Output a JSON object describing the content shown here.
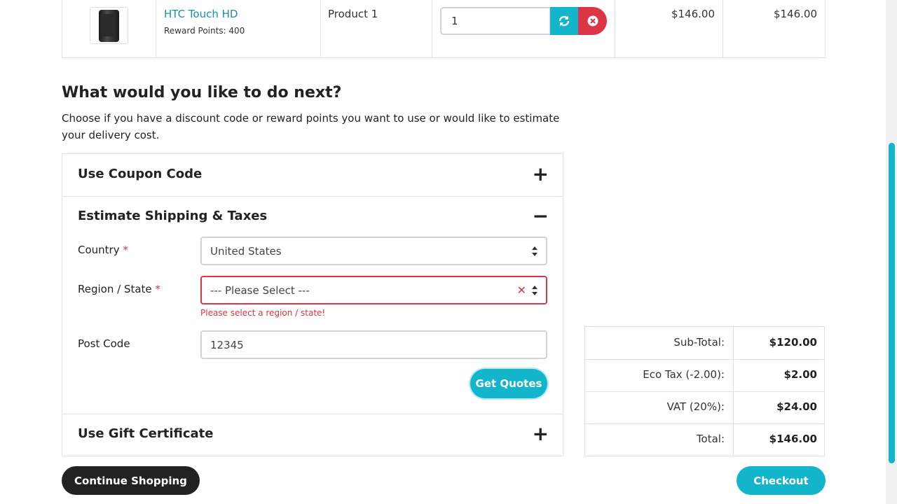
{
  "cart": {
    "product_name": "HTC Touch HD",
    "reward_points": "Reward Points: 400",
    "model": "Product 1",
    "quantity": "1",
    "unit_price": "$146.00",
    "total": "$146.00"
  },
  "next": {
    "heading": "What would you like to do next?",
    "description": "Choose if you have a discount code or reward points you want to use or would like to estimate your delivery cost."
  },
  "coupon": {
    "title": "Use Coupon Code",
    "toggle": "+"
  },
  "shipping": {
    "title": "Estimate Shipping & Taxes",
    "toggle": "−",
    "country_label": "Country",
    "country_value": "United States",
    "region_label": "Region / State",
    "region_value": "--- Please Select ---",
    "region_error": "Please select a region / state!",
    "postcode_label": "Post Code",
    "postcode_value": "12345",
    "get_quotes": "Get Quotes",
    "required_mark": "*"
  },
  "gift": {
    "title": "Use Gift Certificate",
    "toggle": "+"
  },
  "totals": [
    {
      "label": "Sub-Total:",
      "value": "$120.00"
    },
    {
      "label": "Eco Tax (-2.00):",
      "value": "$2.00"
    },
    {
      "label": "VAT (20%):",
      "value": "$24.00"
    },
    {
      "label": "Total:",
      "value": "$146.00"
    }
  ],
  "actions": {
    "continue": "Continue Shopping",
    "checkout": "Checkout"
  },
  "colors": {
    "accent": "#12b5c9",
    "danger": "#dc3545",
    "dark": "#222222"
  },
  "icons": {
    "update": "refresh-icon",
    "remove": "remove-circle-icon",
    "invalid": "x-icon"
  }
}
